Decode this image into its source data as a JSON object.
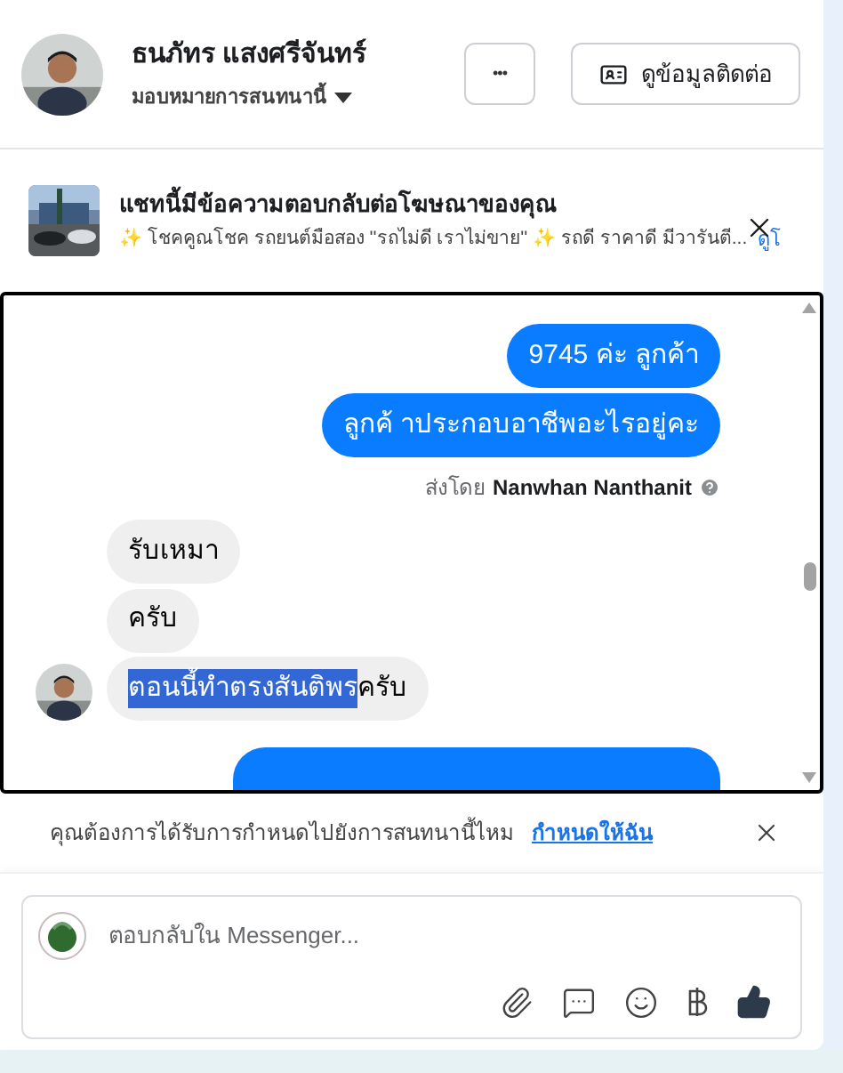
{
  "header": {
    "name": "ธนภัทร แสงศรีจันทร์",
    "assign_label": "มอบหมายการสนทนานี้",
    "more_button": "•••",
    "contact_button": "ดูข้อมูลติดต่อ"
  },
  "ad_banner": {
    "title": "แชทนี้มีข้อความตอบกลับต่อโฆษณาของคุณ",
    "subtitle": "✨ โชคคูณโชค รถยนต์มือสอง ''รถไม่ดี เราไม่ขาย'' ✨ รถดี ราคาดี มีวารันตี...",
    "link": "ดูโ"
  },
  "messages": [
    {
      "kind": "outgoing",
      "segments": [
        {
          "text": "9745 ค่ะ  ลูกค้า",
          "highlighted": false
        }
      ]
    },
    {
      "kind": "outgoing",
      "segments": [
        {
          "text": "ลูกค้ าประกอบอาชีพอะไรอยู่คะ",
          "highlighted": false
        }
      ]
    },
    {
      "kind": "incoming",
      "segments": [
        {
          "text": "รับเหมา",
          "highlighted": false
        }
      ],
      "avatar": false
    },
    {
      "kind": "incoming",
      "segments": [
        {
          "text": "ครับ",
          "highlighted": false
        }
      ],
      "avatar": false
    },
    {
      "kind": "incoming",
      "segments": [
        {
          "text": "ตอนนี้ทำตรงสันติพร",
          "highlighted": true
        },
        {
          "text": "ครับ",
          "highlighted": false
        }
      ],
      "avatar": true
    }
  ],
  "sent_by": {
    "prefix": "ส่งโดย",
    "name": "Nanwhan Nanthanit"
  },
  "assign_prompt": {
    "text": "คุณต้องการได้รับการกำหนดไปยังการสนทนานี้ไหม",
    "link": "กำหนดให้ฉัน"
  },
  "composer": {
    "placeholder": "ตอบกลับใน Messenger..."
  }
}
